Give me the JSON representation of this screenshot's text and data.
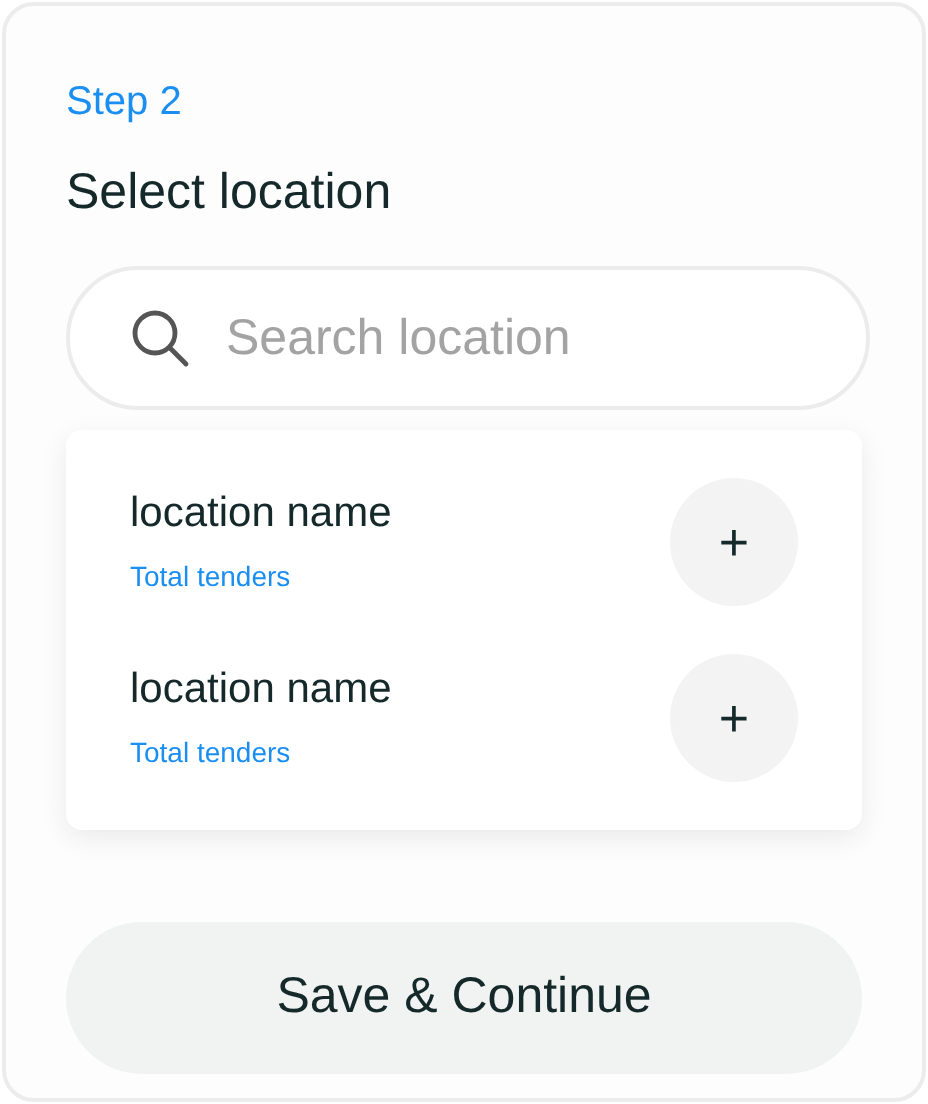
{
  "step": "Step 2",
  "title": "Select location",
  "search": {
    "placeholder": "Search location"
  },
  "locations": [
    {
      "name": "location name",
      "subtitle": "Total tenders",
      "button": "+"
    },
    {
      "name": "location name",
      "subtitle": "Total tenders",
      "button": "+"
    }
  ],
  "primary_button": "Save & Continue"
}
